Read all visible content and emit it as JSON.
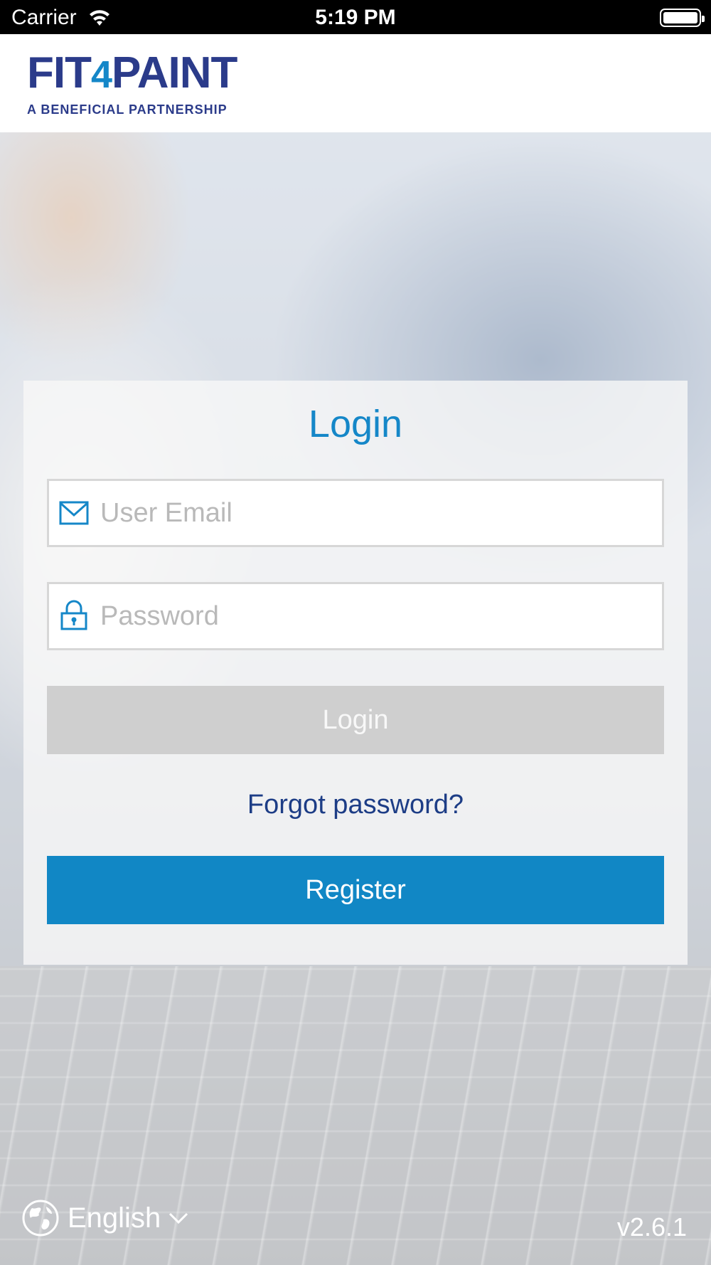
{
  "status_bar": {
    "carrier": "Carrier",
    "time": "5:19 PM"
  },
  "header": {
    "logo_text_fit": "FIT",
    "logo_text_4": "4",
    "logo_text_paint": "PAINT",
    "logo_tagline": "A BENEFICIAL PARTNERSHIP"
  },
  "login": {
    "title": "Login",
    "email_placeholder": "User Email",
    "email_value": "",
    "password_placeholder": "Password",
    "password_value": "",
    "login_button": "Login",
    "forgot_password": "Forgot password?",
    "register_button": "Register"
  },
  "footer": {
    "language": "English",
    "version": "v2.6.1"
  },
  "icons": {
    "email": "envelope-icon",
    "password": "lock-icon",
    "language": "globe-icon",
    "dropdown": "chevron-down-icon"
  },
  "colors": {
    "accent": "#1587c8",
    "brand_navy": "#2b3b8a",
    "link": "#1d3d86",
    "login_disabled": "#cfcfcf",
    "register": "#1187c5"
  }
}
